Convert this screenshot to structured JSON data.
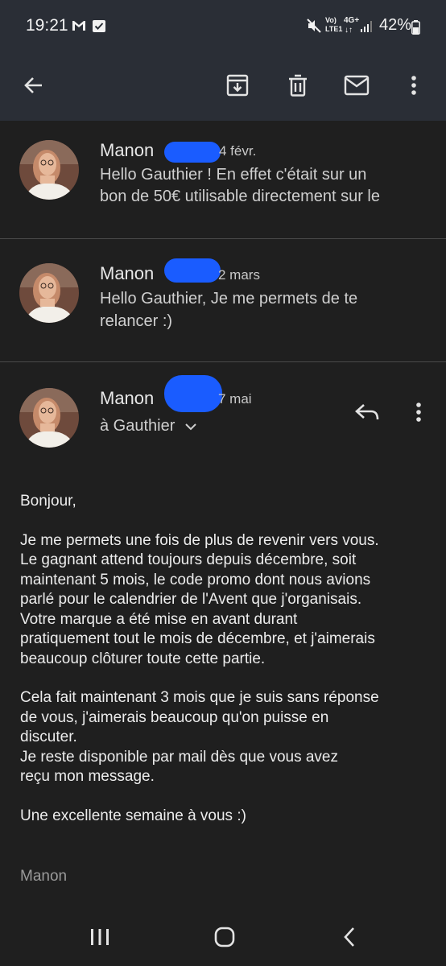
{
  "status_bar": {
    "time": "19:21",
    "left_icons": [
      "gmail-icon",
      "check-square-icon"
    ],
    "right_icons": [
      "mute-icon",
      "volte-icon",
      "lte-icon",
      "signal-icon"
    ],
    "volte_label": "Vo)\nLTE1",
    "network_label": "4G+",
    "battery": "42%"
  },
  "toolbar": {
    "icons": [
      "back-arrow-icon",
      "archive-icon",
      "delete-icon",
      "mark-unread-icon",
      "more-vert-icon"
    ]
  },
  "thread": [
    {
      "sender": "Manon",
      "date": "4 févr.",
      "snippet_line1": "Hello Gauthier ! En effet c'était sur un",
      "snippet_line2": "bon de 50€ utilisable directement sur le"
    },
    {
      "sender": "Manon",
      "date": "2 mars",
      "snippet_line1": "Hello Gauthier, Je me permets de te",
      "snippet_line2": "relancer :)"
    },
    {
      "sender": "Manon",
      "date": "7 mai",
      "recipient": "à Gauthier"
    }
  ],
  "message": {
    "greeting": "Bonjour,",
    "paragraph1": [
      "Je me permets une fois de plus de revenir vers vous.",
      "Le gagnant attend toujours depuis décembre, soit",
      "maintenant 5 mois, le code promo dont nous avions",
      "parlé pour le calendrier de l'Avent que j'organisais.",
      "Votre marque a été mise en avant durant",
      "pratiquement tout le mois de décembre, et j'aimerais",
      "beaucoup clôturer toute cette partie."
    ],
    "paragraph2": [
      "Cela fait maintenant 3 mois que je suis sans réponse",
      "de vous, j'aimerais beaucoup qu'on puisse en",
      "discuter.",
      "Je reste disponible par mail dès que vous avez",
      "reçu mon message."
    ],
    "closing": "Une excellente semaine à vous :)",
    "signature": "Manon"
  },
  "colors": {
    "background": "#1f1f1f",
    "bar": "#2a2e36",
    "redaction": "#1a5cff"
  }
}
